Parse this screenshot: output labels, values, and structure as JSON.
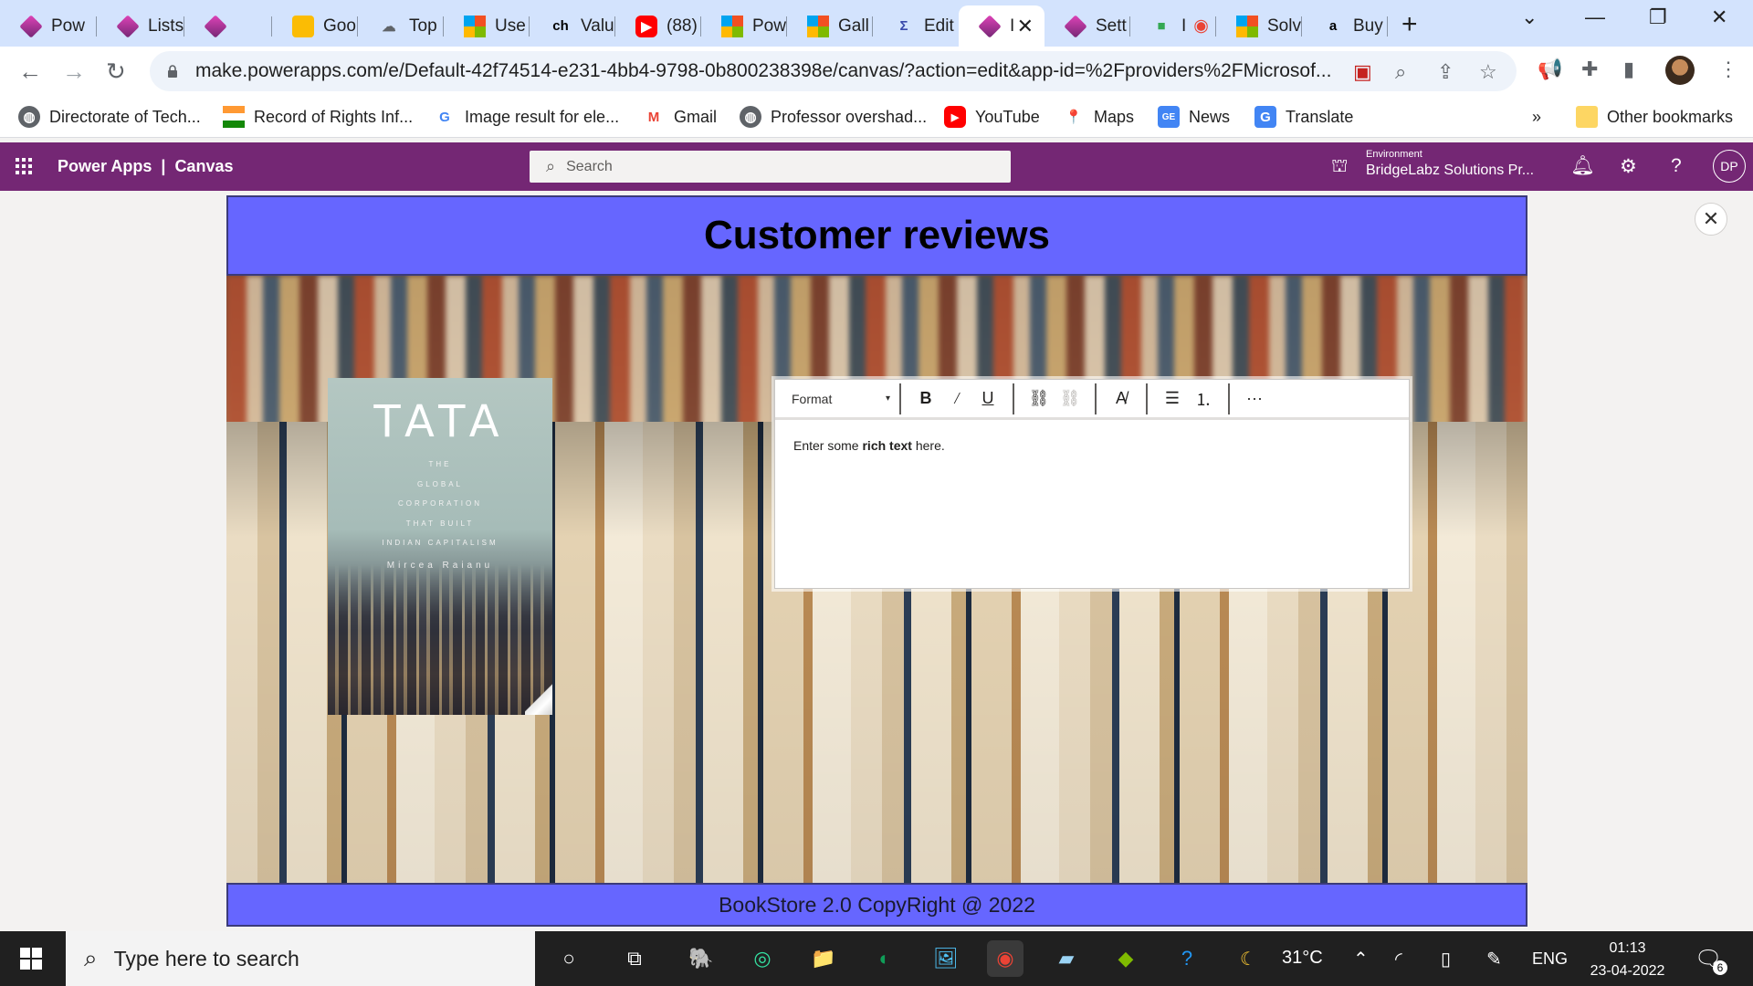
{
  "browser": {
    "tabs": [
      {
        "label": "Pow",
        "icon": "powerapps-icon"
      },
      {
        "label": "Lists",
        "icon": "powerapps-icon"
      },
      {
        "label": "",
        "icon": "powerapps-icon"
      },
      {
        "label": "Goo",
        "icon": "google-keep-icon"
      },
      {
        "label": "Top",
        "icon": "cloud-icon"
      },
      {
        "label": "Use",
        "icon": "microsoft-icon"
      },
      {
        "label": "Valu",
        "icon": "ch-icon"
      },
      {
        "label": "(88)",
        "icon": "youtube-icon"
      },
      {
        "label": "Pow",
        "icon": "microsoft-icon"
      },
      {
        "label": "Gall",
        "icon": "microsoft-icon"
      },
      {
        "label": "Edit",
        "icon": "edit-icon"
      },
      {
        "label": "I",
        "icon": "powerapps-icon"
      },
      {
        "label": "Sett",
        "icon": "powerapps-icon"
      },
      {
        "label": "I",
        "icon": "meet-icon"
      },
      {
        "label": "Solv",
        "icon": "microsoft-icon"
      },
      {
        "label": "Buy",
        "icon": "amazon-icon"
      }
    ],
    "url": "make.powerapps.com/e/Default-42f74514-e231-4bb4-9798-0b800238398e/canvas/?action=edit&app-id=%2Fproviders%2FMicrosof...",
    "bookmarks": {
      "b1": "Directorate of Tech...",
      "b2": "Record of Rights Inf...",
      "b3": "Image result for ele...",
      "b4": "Gmail",
      "b5": "Professor overshad...",
      "b6": "YouTube",
      "b7": "Maps",
      "b8": "News",
      "b9": "Translate",
      "more": "»",
      "other": "Other bookmarks"
    }
  },
  "powerapps": {
    "brand": "Power Apps",
    "divider": "|",
    "mode": "Canvas",
    "search_placeholder": "Search",
    "env_label": "Environment",
    "env_name": "BridgeLabz Solutions Pr...",
    "user_initials": "DP",
    "accent": "#742774"
  },
  "app": {
    "title": "Customer reviews",
    "footer": "BookStore 2.0 CopyRight @ 2022",
    "bar_color": "#6666ff",
    "book": {
      "title": "TATA",
      "subtitle": "THE\nGLOBAL\nCORPORATION\nTHAT BUILT\nINDIAN CAPITALISM",
      "author": "Mircea Raianu"
    },
    "editor": {
      "format_label": "Format",
      "text_before": "Enter some ",
      "text_bold": "rich text",
      "text_after": " here."
    }
  },
  "taskbar": {
    "search_placeholder": "Type here to search",
    "temperature": "31°C",
    "language": "ENG",
    "time": "01:13",
    "date": "23-04-2022",
    "notification_count": "6"
  }
}
